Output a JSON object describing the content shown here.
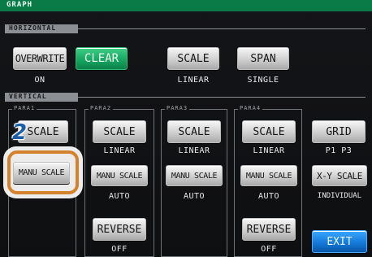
{
  "title": "GRAPH",
  "horizontal": {
    "section_label": "HORIZONTAL",
    "overwrite_label": "OVERWRITE",
    "overwrite_value": "ON",
    "clear_label": "CLEAR",
    "scale_label": "SCALE",
    "scale_value": "LINEAR",
    "span_label": "SPAN",
    "span_value": "SINGLE"
  },
  "vertical": {
    "section_label": "VERTICAL",
    "params": [
      {
        "label": "PARA1",
        "scale_label": "SCALE",
        "manu_scale_label": "MANU SCALE"
      },
      {
        "label": "PARA2",
        "scale_label": "SCALE",
        "scale_value": "LINEAR",
        "manu_scale_label": "MANU SCALE",
        "manu_scale_value": "AUTO",
        "reverse_label": "REVERSE",
        "reverse_value": "OFF"
      },
      {
        "label": "PARA3",
        "scale_label": "SCALE",
        "scale_value": "LINEAR",
        "manu_scale_label": "MANU SCALE",
        "manu_scale_value": "AUTO"
      },
      {
        "label": "PARA4",
        "scale_label": "SCALE",
        "scale_value": "LINEAR",
        "manu_scale_label": "MANU SCALE",
        "manu_scale_value": "AUTO",
        "reverse_label": "REVERSE",
        "reverse_value": "OFF"
      }
    ],
    "grid_label": "GRID",
    "grid_value": "P1 P3",
    "xy_scale_label": "X-Y SCALE",
    "xy_scale_value": "INDIVIDUAL"
  },
  "exit_label": "EXIT",
  "step_marker": "2",
  "colors": {
    "accent_green": "#14a45e",
    "exit_blue": "#1276d6",
    "highlight_orange": "#d4822e",
    "step_blue": "#1c5fa8"
  }
}
